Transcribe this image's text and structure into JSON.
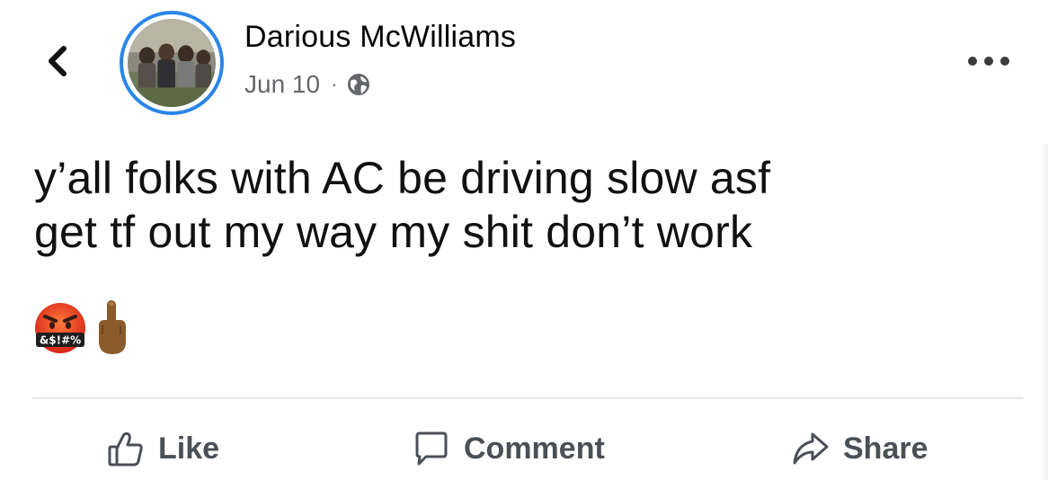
{
  "author": {
    "name": "Darious McWilliams",
    "date": "Jun 10",
    "separator": "·",
    "privacy_icon": "globe-icon"
  },
  "post": {
    "lines": [
      "y’all folks with AC be driving slow asf",
      "get tf out my way my shit don’t work"
    ],
    "emojis": [
      "cursing-face-emoji",
      "middle-finger-emoji"
    ],
    "emoji_symbols": "&$!#%"
  },
  "actions": {
    "like": "Like",
    "comment": "Comment",
    "share": "Share"
  },
  "colors": {
    "avatar_ring": "#2b86e8",
    "action_text": "#4b4f56",
    "meta_text": "#65676b",
    "divider": "#e4e6eb"
  }
}
